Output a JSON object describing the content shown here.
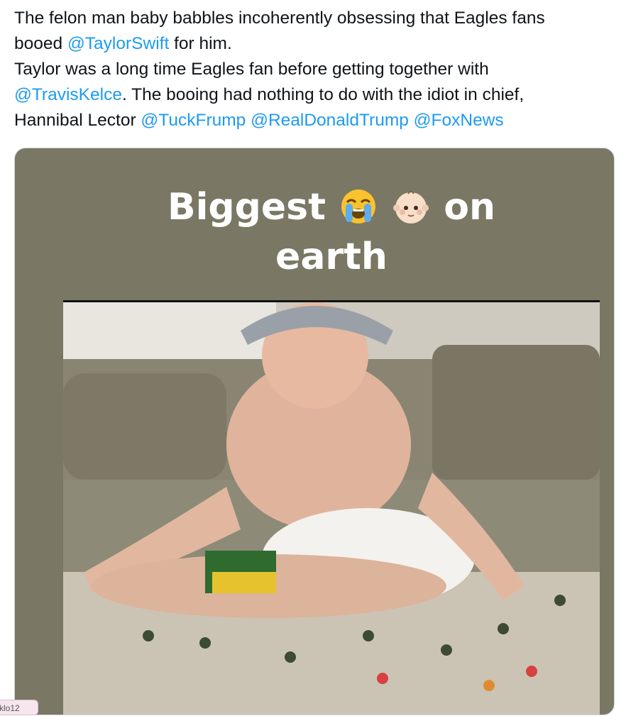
{
  "tweet": {
    "line1_text": "The felon man baby babbles incoherently obsessing that Eagles fans",
    "line2_prefix": "booed ",
    "line2_mention": "@TaylorSwift",
    "line2_suffix": " for him.",
    "line3_text": "Taylor was a long time Eagles fan before getting together with",
    "line4_mention": "@TravisKelce",
    "line4_suffix": ". The booing had nothing to do with the idiot in chief,",
    "line5_prefix": "Hannibal Lector ",
    "mentions_line5": [
      "@TuckFrump",
      "@RealDonaldTrump",
      "@FoxNews"
    ]
  },
  "media": {
    "caption_word1": "Biggest",
    "caption_emoji1": "loudly-crying-face-emoji",
    "caption_emoji2": "baby-face-emoji",
    "caption_word2": "on",
    "caption_line2": "earth"
  },
  "colors": {
    "mention": "#1d9bf0",
    "text": "#0f1419",
    "meme_background": "#7a7764"
  },
  "name_tag": "klo12"
}
